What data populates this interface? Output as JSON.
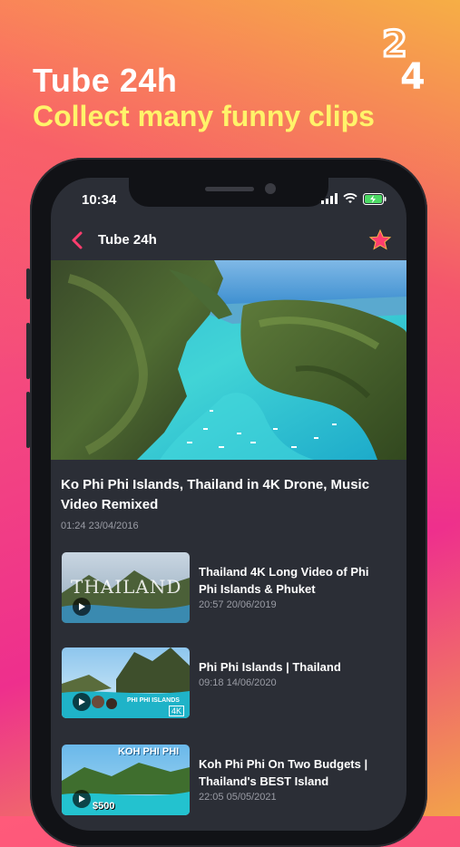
{
  "promo": {
    "title": "Tube 24h",
    "subtitle": "Collect many funny clips",
    "logo_text": "24"
  },
  "status_bar": {
    "time": "10:34"
  },
  "nav": {
    "title": "Tube 24h"
  },
  "featured": {
    "title": "Ko Phi Phi Islands, Thailand in 4K Drone, Music Video Remixed",
    "meta": "01:24 23/04/2016"
  },
  "videos": [
    {
      "title": "Thailand 4K Long Video of  Phi Phi Islands & Phuket",
      "meta": "20:57 20/06/2019",
      "thumb_text": "THAILAND"
    },
    {
      "title": "Phi Phi Islands | Thailand",
      "meta": "09:18 14/06/2020",
      "thumb_text": "PHI PHI ISLANDS",
      "thumb_badge": "4K"
    },
    {
      "title": "Koh Phi Phi On Two Budgets | Thailand's BEST Island",
      "meta": "22:05 05/05/2021",
      "thumb_text": "KOH PHI PHI",
      "thumb_badge": "$500"
    }
  ],
  "colors": {
    "accent_back": "#ff3d6e",
    "star": "#ff3d6e",
    "screen_bg": "#2b2e36",
    "subtitle": "#fff36a"
  }
}
